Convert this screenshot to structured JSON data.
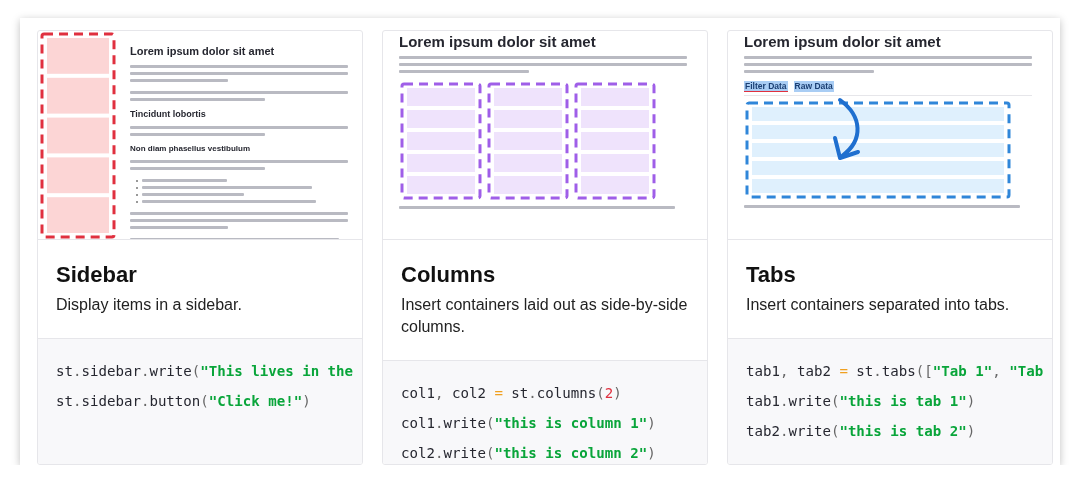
{
  "cards": [
    {
      "title": "Sidebar",
      "description": "Display items in a sidebar.",
      "preview": {
        "kind": "sidebar",
        "blocks": [
          {
            "kind": "h1",
            "text": "Lorem ipsum dolor sit amet"
          },
          {
            "kind": "paragraph"
          },
          {
            "kind": "sentence"
          },
          {
            "kind": "h2",
            "text": "Tincidunt lobortis"
          },
          {
            "kind": "sentence"
          },
          {
            "kind": "h3",
            "text": "Non diam phasellus vestibulum"
          },
          {
            "kind": "sentence"
          },
          {
            "kind": "list"
          },
          {
            "kind": "paragraph"
          },
          {
            "kind": "line"
          }
        ]
      },
      "code": [
        [
          {
            "kind": "name",
            "text": "st"
          },
          {
            "kind": "punct",
            "text": "."
          },
          {
            "kind": "name",
            "text": "sidebar"
          },
          {
            "kind": "punct",
            "text": "."
          },
          {
            "kind": "name",
            "text": "write"
          },
          {
            "kind": "punct",
            "text": "("
          },
          {
            "kind": "string",
            "text": "\"This lives in the"
          }
        ],
        [
          {
            "kind": "name",
            "text": "st"
          },
          {
            "kind": "punct",
            "text": "."
          },
          {
            "kind": "name",
            "text": "sidebar"
          },
          {
            "kind": "punct",
            "text": "."
          },
          {
            "kind": "name",
            "text": "button"
          },
          {
            "kind": "punct",
            "text": "("
          },
          {
            "kind": "string",
            "text": "\"Click me!\""
          },
          {
            "kind": "punct",
            "text": ")"
          }
        ]
      ]
    },
    {
      "title": "Columns",
      "description": "Insert containers laid out as side-by-side columns.",
      "preview": {
        "kind": "columns",
        "blocks": [
          {
            "kind": "h1",
            "text": "Lorem ipsum dolor sit amet"
          },
          {
            "kind": "paragraph"
          },
          {
            "kind": "columns-drawing"
          },
          {
            "kind": "line"
          }
        ]
      },
      "code": [
        [
          {
            "kind": "name",
            "text": "col1"
          },
          {
            "kind": "punct",
            "text": ", "
          },
          {
            "kind": "name",
            "text": "col2"
          },
          {
            "kind": "op",
            "text": " = "
          },
          {
            "kind": "name",
            "text": "st"
          },
          {
            "kind": "punct",
            "text": "."
          },
          {
            "kind": "name",
            "text": "columns"
          },
          {
            "kind": "punct",
            "text": "("
          },
          {
            "kind": "number",
            "text": "2"
          },
          {
            "kind": "punct",
            "text": ")"
          }
        ],
        [
          {
            "kind": "name",
            "text": "col1"
          },
          {
            "kind": "punct",
            "text": "."
          },
          {
            "kind": "name",
            "text": "write"
          },
          {
            "kind": "punct",
            "text": "("
          },
          {
            "kind": "string",
            "text": "\"this is column 1\""
          },
          {
            "kind": "punct",
            "text": ")"
          }
        ],
        [
          {
            "kind": "name",
            "text": "col2"
          },
          {
            "kind": "punct",
            "text": "."
          },
          {
            "kind": "name",
            "text": "write"
          },
          {
            "kind": "punct",
            "text": "("
          },
          {
            "kind": "string",
            "text": "\"this is column 2\""
          },
          {
            "kind": "punct",
            "text": ")"
          }
        ]
      ]
    },
    {
      "title": "Tabs",
      "description": "Insert containers separated into tabs.",
      "preview": {
        "kind": "tabs",
        "blocks": [
          {
            "kind": "h1",
            "text": "Lorem ipsum dolor sit amet"
          },
          {
            "kind": "paragraph"
          },
          {
            "kind": "tabs",
            "items": [
              {
                "label": "Filter Data",
                "selected": true
              },
              {
                "label": "Raw Data",
                "selected": false
              }
            ]
          },
          {
            "kind": "tabs-drawing"
          },
          {
            "kind": "line"
          }
        ]
      },
      "code": [
        [
          {
            "kind": "name",
            "text": "tab1"
          },
          {
            "kind": "punct",
            "text": ", "
          },
          {
            "kind": "name",
            "text": "tab2"
          },
          {
            "kind": "op",
            "text": " = "
          },
          {
            "kind": "name",
            "text": "st"
          },
          {
            "kind": "punct",
            "text": "."
          },
          {
            "kind": "name",
            "text": "tabs"
          },
          {
            "kind": "punct",
            "text": "(["
          },
          {
            "kind": "string",
            "text": "\"Tab 1\""
          },
          {
            "kind": "punct",
            "text": ", "
          },
          {
            "kind": "string",
            "text": "\"Tab"
          }
        ],
        [
          {
            "kind": "name",
            "text": "tab1"
          },
          {
            "kind": "punct",
            "text": "."
          },
          {
            "kind": "name",
            "text": "write"
          },
          {
            "kind": "punct",
            "text": "("
          },
          {
            "kind": "string",
            "text": "\"this is tab 1\""
          },
          {
            "kind": "punct",
            "text": ")"
          }
        ],
        [
          {
            "kind": "name",
            "text": "tab2"
          },
          {
            "kind": "punct",
            "text": "."
          },
          {
            "kind": "name",
            "text": "write"
          },
          {
            "kind": "punct",
            "text": "("
          },
          {
            "kind": "string",
            "text": "\"this is tab 2\""
          },
          {
            "kind": "punct",
            "text": ")"
          }
        ]
      ]
    }
  ]
}
